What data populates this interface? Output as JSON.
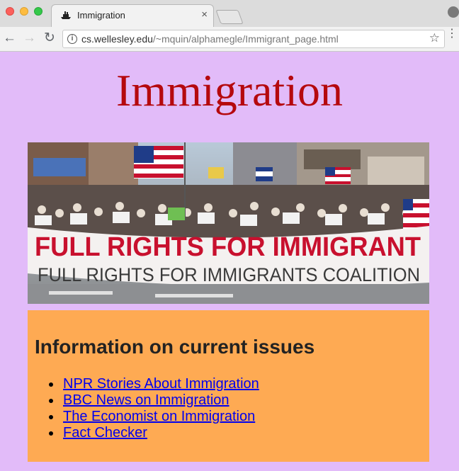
{
  "browser": {
    "tab_title": "Immigration",
    "tab_close": "×",
    "url_host": "cs.wellesley.edu",
    "url_path": "/~mquin/alphamegle/Immigrant_page.html",
    "info_icon_text": "i",
    "nav": {
      "back": "←",
      "forward": "→",
      "reload": "↻"
    },
    "star": "☆",
    "menu": "⋮"
  },
  "page": {
    "title": "Immigration",
    "banner": {
      "line1": "FULL RIGHTS FOR IMMIGRANT",
      "line2": "FULL RIGHTS FOR IMMIGRANTS COALITION"
    },
    "info_heading": "Information on current issues",
    "links": [
      "NPR Stories About Immigration",
      "BBC News on Immigration",
      "The Economist on Immigration",
      "Fact Checker"
    ]
  },
  "colors": {
    "page_background": "#e2bbf9",
    "title_color": "#b5090e",
    "info_background": "#feaa53",
    "link_color": "#0000ee"
  }
}
